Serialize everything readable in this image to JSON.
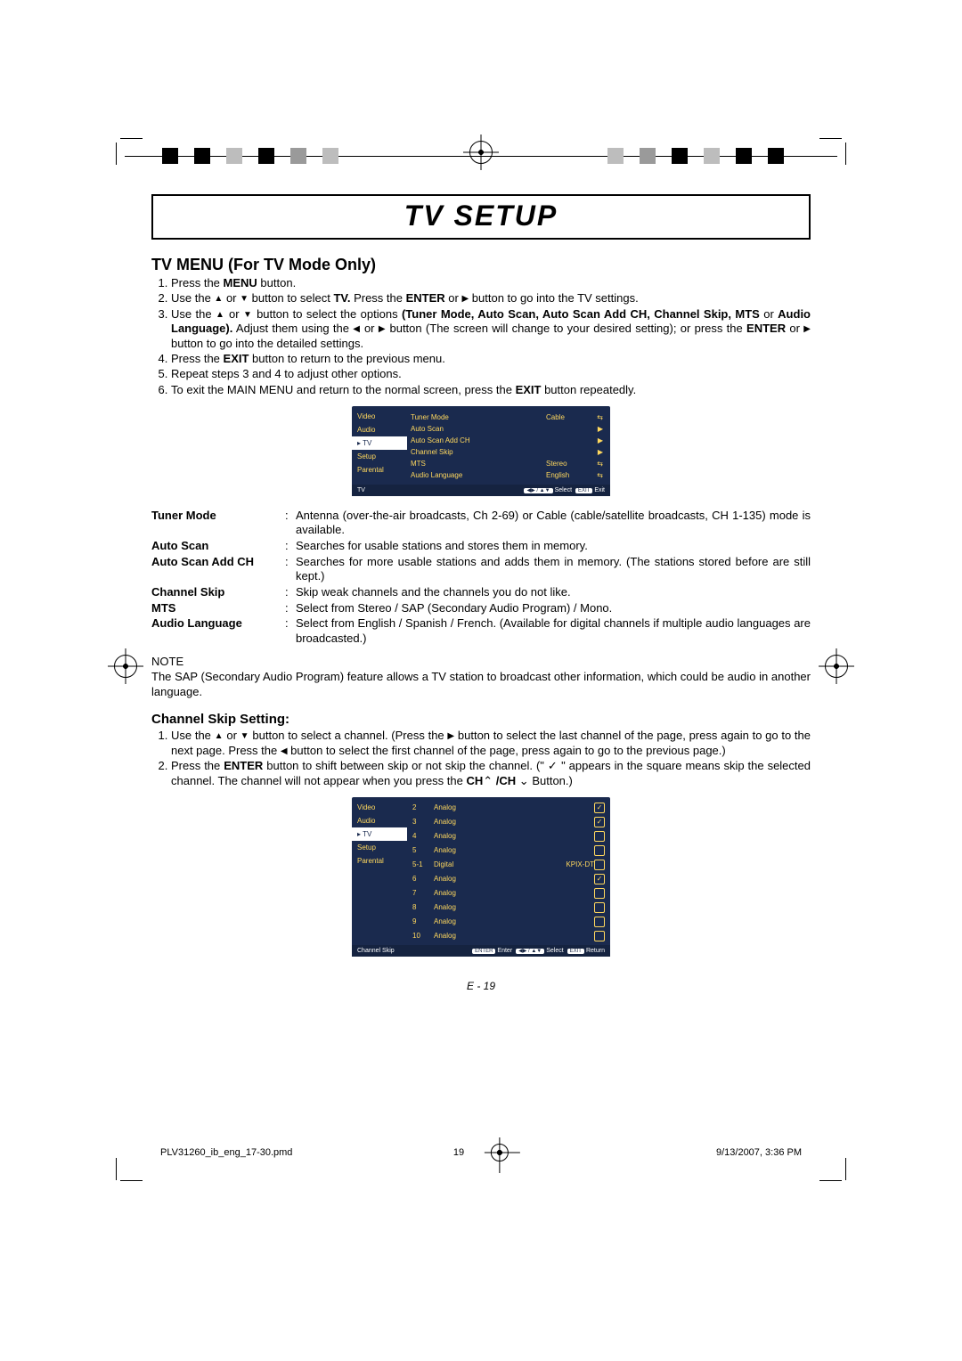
{
  "title": "TV SETUP",
  "subtitle": "TV MENU (For TV Mode Only)",
  "steps1": {
    "s1a": "Press the ",
    "s1b": "MENU",
    "s1c": " button.",
    "s2a": "Use the ",
    "s2b": " or ",
    "s2c": " button to select ",
    "s2d": "TV.",
    "s2e": " Press the ",
    "s2f": "ENTER",
    "s2g": " or ",
    "s2h": " button to go into the TV settings.",
    "s3a": "Use the ",
    "s3b": " or ",
    "s3c": " button to select the options ",
    "s3d": "(Tuner Mode, Auto Scan, Auto Scan Add CH, Channel Skip, MTS",
    "s3e": " or ",
    "s3f": "Audio Language).",
    "s3g": " Adjust them using the ",
    "s3h": " or ",
    "s3i": " button (The screen will change to your desired setting); or press the ",
    "s3j": "ENTER",
    "s3k": " or ",
    "s3l": " button to go into the detailed settings.",
    "s4a": "Press the ",
    "s4b": "EXIT",
    "s4c": " button to return to the previous menu.",
    "s5": "Repeat steps 3 and 4 to adjust other options.",
    "s6a": "To exit the MAIN MENU and return to the normal screen, press the ",
    "s6b": "EXIT",
    "s6c": " button repeatedly."
  },
  "osd1": {
    "side": [
      "Video",
      "Audio",
      "TV",
      "Setup",
      "Parental"
    ],
    "rows": [
      {
        "label": "Tuner Mode",
        "val": "Cable",
        "icon": "⇆"
      },
      {
        "label": "Auto Scan",
        "val": "",
        "icon": "▶"
      },
      {
        "label": "Auto Scan Add CH",
        "val": "",
        "icon": "▶"
      },
      {
        "label": "Channel Skip",
        "val": "",
        "icon": "▶"
      },
      {
        "label": "MTS",
        "val": "Stereo",
        "icon": "⇆"
      },
      {
        "label": "Audio Language",
        "val": "English",
        "icon": "⇆"
      }
    ],
    "footerLabel": "TV",
    "footerSelect": "Select",
    "footerExit1": "EXIT",
    "footerExit2": "Exit",
    "footerNav": "◀▶ / ▲▼"
  },
  "defs": {
    "tuner_mode": {
      "term": "Tuner Mode",
      "desc": "Antenna (over-the-air broadcasts, Ch 2-69) or Cable (cable/satellite broadcasts, CH 1-135) mode is available."
    },
    "auto_scan": {
      "term": "Auto Scan",
      "desc": "Searches for usable stations and stores them in memory."
    },
    "auto_scan_add": {
      "term": "Auto Scan Add CH",
      "desc": "Searches for more usable stations and adds them in memory. (The stations stored before are still kept.)"
    },
    "channel_skip": {
      "term": "Channel Skip",
      "desc": "Skip weak channels and the channels you do not like."
    },
    "mts": {
      "term": "MTS",
      "desc": "Select from Stereo / SAP (Secondary Audio Program) / Mono."
    },
    "audio_language": {
      "term": "Audio Language",
      "desc": "Select from English / Spanish / French. (Available for digital channels if multiple audio languages are broadcasted.)"
    }
  },
  "note_label": "NOTE",
  "note": "The SAP (Secondary Audio Program) feature allows a TV station to broadcast other information, which could be audio in another language.",
  "subtitle2": "Channel Skip Setting:",
  "steps2": {
    "s1a": "Use the ",
    "s1b": " or ",
    "s1c": " button to select a channel. (Press the ",
    "s1d": " button to select the last channel of the page, press again to go to the next page. Press the ",
    "s1e": " button to select the first channel of the page, press again to go to the previous page.)",
    "s2a": "Press the ",
    "s2b": "ENTER",
    "s2c": " button to shift between skip or not skip the channel. (\" ",
    "s2d": " \" appears in the square means skip the selected channel. The channel will not appear when you press the ",
    "s2e": "CH",
    "s2f": " /CH ",
    "s2g": " Button.)"
  },
  "osd2": {
    "side": [
      "Video",
      "Audio",
      "TV",
      "Setup",
      "Parental"
    ],
    "rows": [
      {
        "ch": "2",
        "type": "Analog",
        "name": "",
        "skip": true
      },
      {
        "ch": "3",
        "type": "Analog",
        "name": "",
        "skip": true
      },
      {
        "ch": "4",
        "type": "Analog",
        "name": "",
        "skip": false
      },
      {
        "ch": "5",
        "type": "Analog",
        "name": "",
        "skip": false
      },
      {
        "ch": "5-1",
        "type": "Digital",
        "name": "KPIX-DT",
        "skip": false
      },
      {
        "ch": "6",
        "type": "Analog",
        "name": "",
        "skip": true
      },
      {
        "ch": "7",
        "type": "Analog",
        "name": "",
        "skip": false
      },
      {
        "ch": "8",
        "type": "Analog",
        "name": "",
        "skip": false
      },
      {
        "ch": "9",
        "type": "Analog",
        "name": "",
        "skip": false
      },
      {
        "ch": "10",
        "type": "Analog",
        "name": "",
        "skip": false
      }
    ],
    "footerLabel": "Channel Skip",
    "footerEnter1": "ENTER",
    "footerEnter2": "Enter",
    "footerNav": "◀▶ / ▲▼",
    "footerSelect": "Select",
    "footerExit1": "EXIT",
    "footerExit2": "Return"
  },
  "page_number": "E - 19",
  "pmd_file": "PLV31260_ib_eng_17-30.pmd",
  "pmd_page": "19",
  "pmd_date": "9/13/2007, 3:36 PM"
}
